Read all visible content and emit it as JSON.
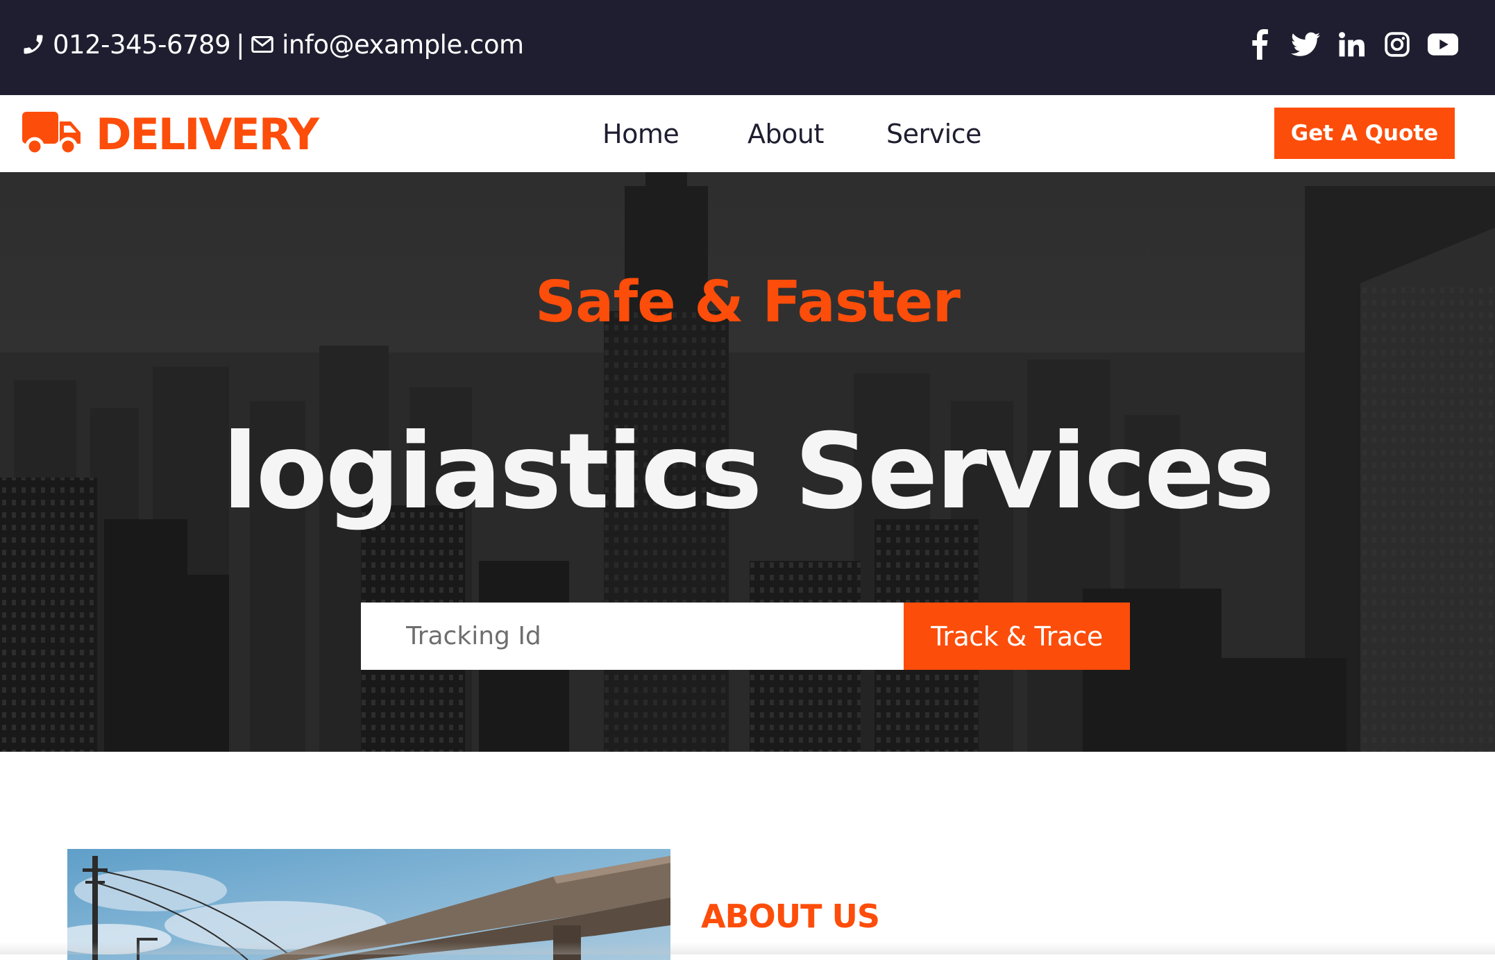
{
  "topbar": {
    "phone": "012-345-6789",
    "separator": "|",
    "email": "info@example.com",
    "socials": [
      "facebook-icon",
      "twitter-icon",
      "linkedin-icon",
      "instagram-icon",
      "youtube-icon"
    ]
  },
  "nav": {
    "brand": "DELIVERY",
    "links": [
      "Home",
      "About",
      "Service"
    ],
    "cta": "Get A Quote"
  },
  "hero": {
    "subtitle": "Safe & Faster",
    "title": "logiastics Services",
    "tracking_placeholder": "Tracking Id",
    "track_button": "Track & Trace"
  },
  "about": {
    "heading": "ABOUT US"
  },
  "colors": {
    "accent": "#fd4d0a",
    "dark": "#1f1e30",
    "white": "#ffffff"
  }
}
